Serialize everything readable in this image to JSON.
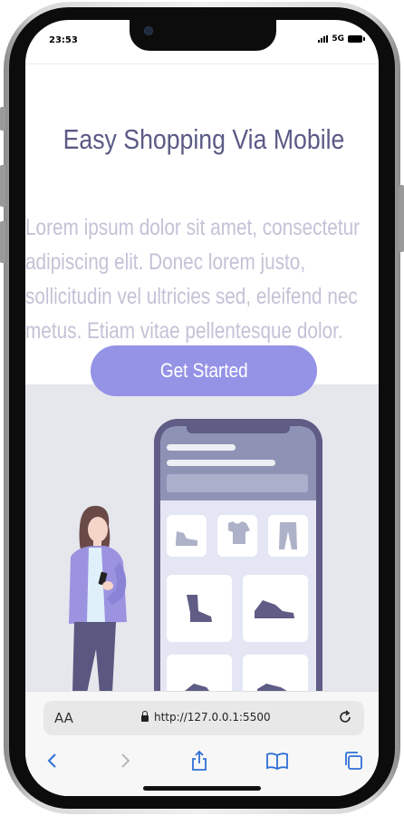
{
  "status_bar": {
    "time": "23:53",
    "network": "5G"
  },
  "hero": {
    "title": "Easy Shopping Via Mobile",
    "body": "Lorem ipsum dolor sit amet, consectetur adipiscing elit. Donec lorem justo, sollicitudin vel ultricies sed, eleifend nec metus. Etiam vitae pellentesque dolor.",
    "cta_label": "Get Started"
  },
  "illustration": {
    "product_icons": [
      "sneaker-icon",
      "tshirt-icon",
      "pants-icon",
      "boot-icon",
      "sneaker-icon",
      "shoe-icon",
      "shoe-icon"
    ]
  },
  "browser": {
    "text_size_label": "AA",
    "url": "http://127.0.0.1:5500",
    "toolbar_icons": [
      "back-icon",
      "forward-icon",
      "share-icon",
      "bookmarks-icon",
      "tabs-icon"
    ]
  },
  "colors": {
    "accent": "#9593e6",
    "title": "#5a5a86",
    "body_text": "#c4c2d6",
    "illustration_bg": "#e6e6ed",
    "phone_frame": "#5f5c86"
  }
}
